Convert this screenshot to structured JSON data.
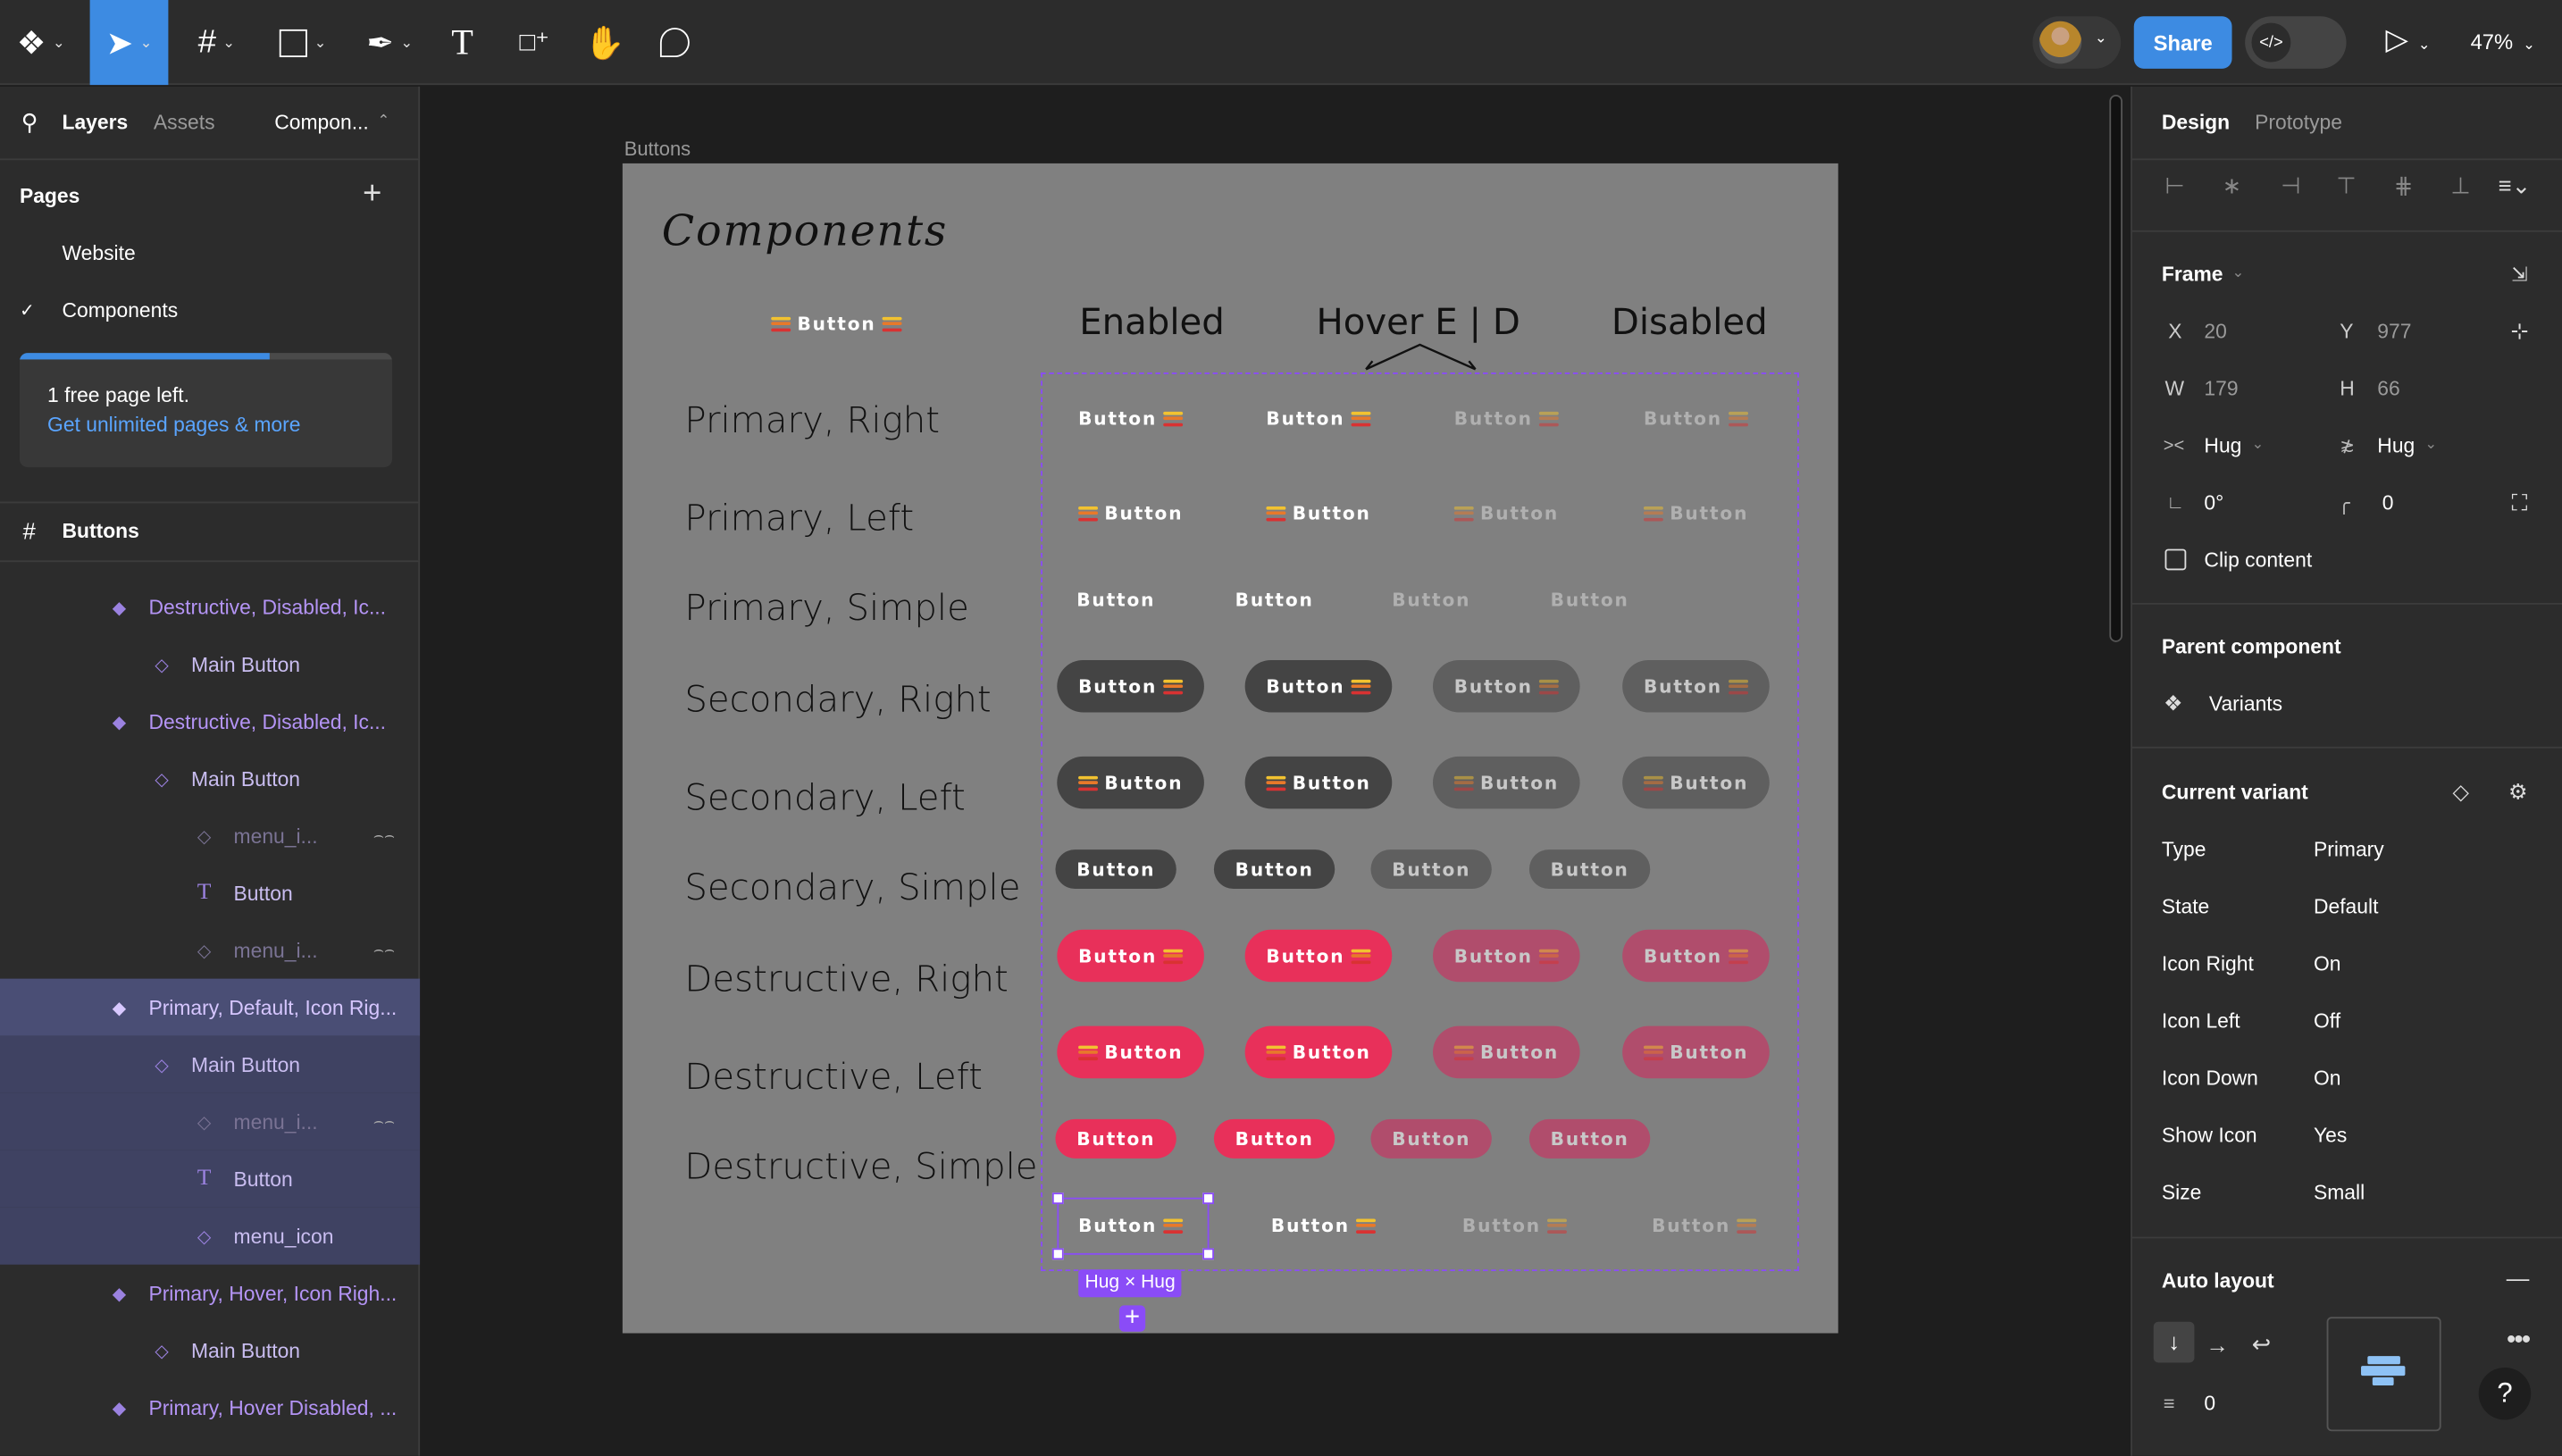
{
  "toolbar": {
    "tools": [
      {
        "name": "main-menu",
        "icon": "figma-logo-icon"
      },
      {
        "name": "move-tool",
        "icon": "cursor-icon",
        "active": true
      },
      {
        "name": "frame-tool",
        "icon": "frame-icon"
      },
      {
        "name": "shape-tool",
        "icon": "rectangle-icon"
      },
      {
        "name": "pen-tool",
        "icon": "pen-icon"
      },
      {
        "name": "text-tool",
        "icon": "text-icon"
      },
      {
        "name": "resources-tool",
        "icon": "resources-icon"
      },
      {
        "name": "hand-tool",
        "icon": "hand-icon"
      },
      {
        "name": "comment-tool",
        "icon": "comment-icon"
      }
    ],
    "share_label": "Share",
    "zoom": "47%",
    "accent": "#3d8be2"
  },
  "left_panel": {
    "tabs": {
      "layers": "Layers",
      "assets": "Assets",
      "page_dropdown": "Compon..."
    },
    "pages_title": "Pages",
    "pages": [
      {
        "label": "Website",
        "current": false
      },
      {
        "label": "Components",
        "current": true
      }
    ],
    "upsell": {
      "text": "1 free page left.",
      "link": "Get unlimited pages & more",
      "progress": 0.67
    },
    "frame_title": "Buttons",
    "layers": [
      {
        "level": 1,
        "type": "component-set",
        "label": "Destructive, Disabled, Ic..."
      },
      {
        "level": 2,
        "type": "instance",
        "label": "Main Button"
      },
      {
        "level": 1,
        "type": "component-set",
        "label": "Destructive, Disabled, Ic..."
      },
      {
        "level": 2,
        "type": "instance",
        "label": "Main Button"
      },
      {
        "level": 3,
        "type": "instance",
        "label": "menu_i...",
        "hidden": true
      },
      {
        "level": 3,
        "type": "text",
        "label": "Button"
      },
      {
        "level": 3,
        "type": "instance",
        "label": "menu_i...",
        "hidden": true
      },
      {
        "level": 1,
        "type": "component-set",
        "label": "Primary, Default, Icon Rig...",
        "selected": true
      },
      {
        "level": 2,
        "type": "instance",
        "label": "Main Button",
        "ingroup": true
      },
      {
        "level": 3,
        "type": "instance",
        "label": "menu_i...",
        "hidden": true,
        "ingroup": true
      },
      {
        "level": 3,
        "type": "text",
        "label": "Button",
        "ingroup": true
      },
      {
        "level": 3,
        "type": "instance",
        "label": "menu_icon",
        "ingroup": true
      },
      {
        "level": 1,
        "type": "component-set",
        "label": "Primary, Hover, Icon Righ..."
      },
      {
        "level": 2,
        "type": "instance",
        "label": "Main Button"
      },
      {
        "level": 1,
        "type": "component-set",
        "label": "Primary, Hover Disabled, ..."
      }
    ]
  },
  "canvas": {
    "frame_label": "Buttons",
    "title": "Components",
    "header_button": "Button",
    "columns": [
      "Enabled",
      "Hover E | D",
      "Disabled"
    ],
    "button_text": "Button",
    "rows": [
      {
        "label": "Primary, Right",
        "variant": "primary",
        "icon": "right"
      },
      {
        "label": "Primary, Left",
        "variant": "primary",
        "icon": "left"
      },
      {
        "label": "Primary, Simple",
        "variant": "primary",
        "icon": "none"
      },
      {
        "label": "Secondary, Right",
        "variant": "secondary",
        "icon": "right"
      },
      {
        "label": "Secondary, Left",
        "variant": "secondary",
        "icon": "left"
      },
      {
        "label": "Secondary, Simple",
        "variant": "secondary",
        "icon": "none"
      },
      {
        "label": "Destructive, Right",
        "variant": "destructive",
        "icon": "right"
      },
      {
        "label": "Destructive, Left",
        "variant": "destructive",
        "icon": "left"
      },
      {
        "label": "Destructive, Simple",
        "variant": "destructive",
        "icon": "none"
      },
      {
        "label": "",
        "variant": "primary",
        "icon": "right"
      }
    ],
    "selection_label": "Hug × Hug",
    "colors": {
      "frame": "#808080",
      "secondary": "#444444",
      "secondary_disabled": "#5f5f5f",
      "destructive": "#e8305a",
      "destructive_disabled": "#b04d6c",
      "selection": "#8a4cf7",
      "icon_lines": [
        "#f2c230",
        "#e8792a",
        "#d93232"
      ]
    }
  },
  "right_panel": {
    "tabs": {
      "design": "Design",
      "prototype": "Prototype"
    },
    "frame": {
      "title": "Frame",
      "x_label": "X",
      "x": "20",
      "y_label": "Y",
      "y": "977",
      "w_label": "W",
      "w": "179",
      "h_label": "H",
      "h": "66",
      "hsize": "Hug",
      "vsize": "Hug",
      "rotation": "0°",
      "radius": "0",
      "clip_label": "Clip content",
      "clip": false
    },
    "parent": {
      "title": "Parent component",
      "name": "Variants"
    },
    "variant": {
      "title": "Current variant",
      "props": [
        {
          "k": "Type",
          "v": "Primary"
        },
        {
          "k": "State",
          "v": "Default"
        },
        {
          "k": "Icon Right",
          "v": "On"
        },
        {
          "k": "Icon Left",
          "v": "Off"
        },
        {
          "k": "Icon Down",
          "v": "On"
        },
        {
          "k": "Show Icon",
          "v": "Yes"
        },
        {
          "k": "Size",
          "v": "Small"
        }
      ]
    },
    "auto_layout": {
      "title": "Auto layout",
      "direction": "vertical",
      "gap": "0"
    },
    "help": "?"
  }
}
